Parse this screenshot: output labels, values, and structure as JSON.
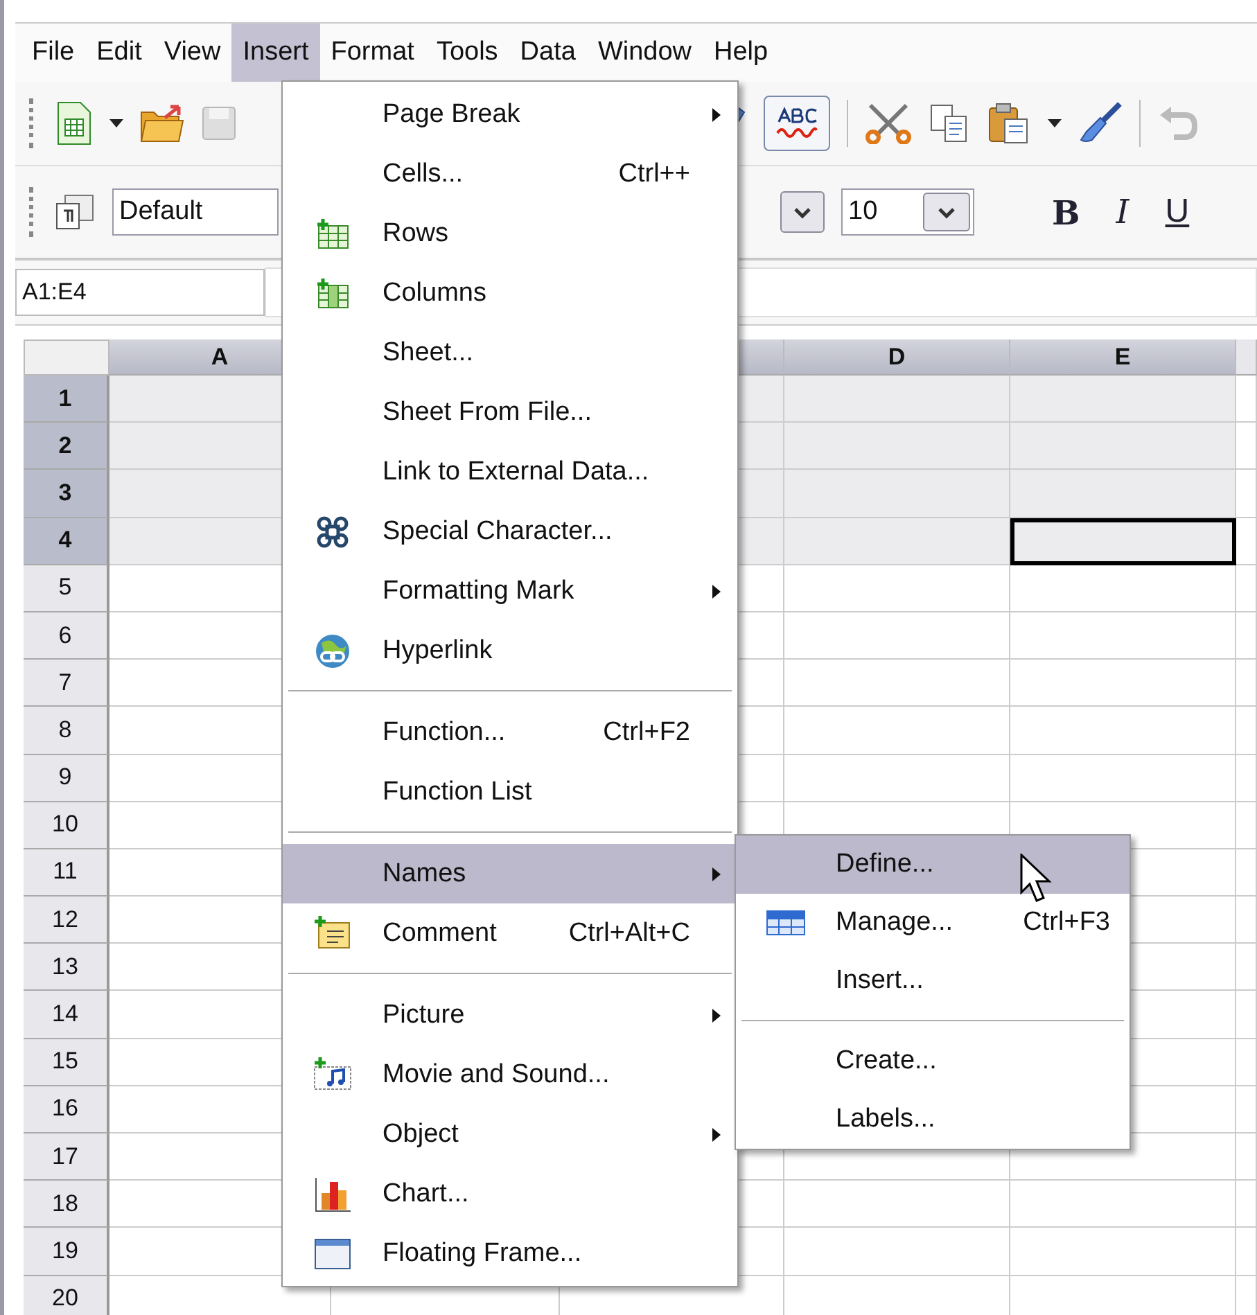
{
  "menubar": [
    {
      "label": "File",
      "selected": false
    },
    {
      "label": "Edit",
      "selected": false
    },
    {
      "label": "View",
      "selected": false
    },
    {
      "label": "Insert",
      "selected": true
    },
    {
      "label": "Format",
      "selected": false
    },
    {
      "label": "Tools",
      "selected": false
    },
    {
      "label": "Data",
      "selected": false
    },
    {
      "label": "Window",
      "selected": false
    },
    {
      "label": "Help",
      "selected": false
    }
  ],
  "formatting_toolbar": {
    "paragraph_style": "Default",
    "font_size": "10",
    "buttons": [
      {
        "kind": "bold",
        "label": "B"
      },
      {
        "kind": "italic",
        "label": "I"
      },
      {
        "kind": "underline",
        "label": "U"
      }
    ]
  },
  "name_box": "A1:E4",
  "columns": [
    {
      "kind": "labeled",
      "label": "A",
      "selected": true
    },
    {
      "kind": "covered"
    },
    {
      "kind": "covered",
      "selected": true
    },
    {
      "kind": "labeled",
      "label": "D",
      "selected": true
    },
    {
      "kind": "labeled",
      "label": "E",
      "selected": true
    }
  ],
  "rows": [
    {
      "label": "1",
      "selected": true
    },
    {
      "label": "2",
      "selected": true
    },
    {
      "label": "3",
      "selected": true
    },
    {
      "label": "4",
      "selected": true
    },
    {
      "label": "5",
      "selected": false
    },
    {
      "label": "6",
      "selected": false
    },
    {
      "label": "7",
      "selected": false
    },
    {
      "label": "8",
      "selected": false
    },
    {
      "label": "9",
      "selected": false
    },
    {
      "label": "10",
      "selected": false
    },
    {
      "label": "11",
      "selected": false
    },
    {
      "label": "12",
      "selected": false
    },
    {
      "label": "13",
      "selected": false
    },
    {
      "label": "14",
      "selected": false
    },
    {
      "label": "15",
      "selected": false
    },
    {
      "label": "16",
      "selected": false
    },
    {
      "label": "17",
      "selected": false
    },
    {
      "label": "18",
      "selected": false
    },
    {
      "label": "19",
      "selected": false
    },
    {
      "label": "20",
      "selected": false
    }
  ],
  "insert_menu": [
    {
      "kind": "item",
      "label": "Page Break",
      "has_submenu": true,
      "selected": false
    },
    {
      "kind": "item",
      "label": "Cells...",
      "shortcut": "Ctrl++",
      "has_submenu": false,
      "selected": false
    },
    {
      "kind": "item",
      "label": "Rows",
      "has_submenu": false,
      "selected": false
    },
    {
      "kind": "item",
      "label": "Columns",
      "has_submenu": false,
      "selected": false
    },
    {
      "kind": "item",
      "label": "Sheet...",
      "has_submenu": false,
      "selected": false
    },
    {
      "kind": "item",
      "label": "Sheet From File...",
      "has_submenu": false,
      "selected": false
    },
    {
      "kind": "item",
      "label": "Link to External Data...",
      "has_submenu": false,
      "selected": false
    },
    {
      "kind": "item",
      "label": "Special Character...",
      "has_submenu": false,
      "selected": false
    },
    {
      "kind": "item",
      "label": "Formatting Mark",
      "has_submenu": true,
      "selected": false
    },
    {
      "kind": "item",
      "label": "Hyperlink",
      "has_submenu": false,
      "selected": false
    },
    {
      "kind": "separator"
    },
    {
      "kind": "item",
      "label": "Function...",
      "shortcut": "Ctrl+F2",
      "has_submenu": false,
      "selected": false
    },
    {
      "kind": "item",
      "label": "Function List",
      "has_submenu": false,
      "selected": false
    },
    {
      "kind": "separator"
    },
    {
      "kind": "item",
      "label": "Names",
      "has_submenu": true,
      "selected": true,
      "submenu": [
        {
          "kind": "item",
          "label": "Define...",
          "selected": true
        },
        {
          "kind": "item",
          "label": "Manage...",
          "shortcut": "Ctrl+F3",
          "selected": false
        },
        {
          "kind": "item",
          "label": "Insert...",
          "selected": false
        },
        {
          "kind": "separator"
        },
        {
          "kind": "item",
          "label": "Create...",
          "selected": false
        },
        {
          "kind": "item",
          "label": "Labels...",
          "selected": false
        }
      ]
    },
    {
      "kind": "item",
      "label": "Comment",
      "shortcut": "Ctrl+Alt+C",
      "has_submenu": false,
      "selected": false
    },
    {
      "kind": "separator"
    },
    {
      "kind": "item",
      "label": "Picture",
      "has_submenu": true,
      "selected": false
    },
    {
      "kind": "item",
      "label": "Movie and Sound...",
      "has_submenu": false,
      "selected": false
    },
    {
      "kind": "item",
      "label": "Object",
      "has_submenu": true,
      "selected": false
    },
    {
      "kind": "item",
      "label": "Chart...",
      "has_submenu": false,
      "selected": false
    },
    {
      "kind": "item",
      "label": "Floating Frame...",
      "has_submenu": false,
      "selected": false
    }
  ]
}
